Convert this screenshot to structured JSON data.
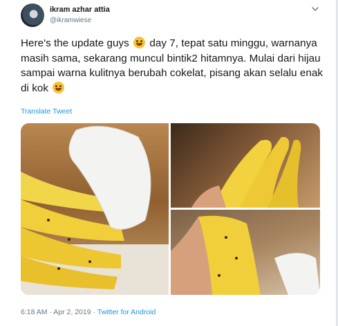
{
  "user": {
    "name": "ikram azhar attia",
    "handle": "@ikramwiese"
  },
  "tweet": {
    "text_part1": "Here's the update guys",
    "text_part2": "day 7, tepat satu minggu, warnanya masih sama, sekarang muncul bintik2 hitamnya. Mulai dari hijau sampai warna kulitnya berubah cokelat, pisang akan selalu enak di kok",
    "translate_label": "Translate Tweet"
  },
  "icons": {
    "menu": "chevron-down-icon",
    "emoji1": "grinning-face-emoji",
    "emoji2": "face-savoring-food-emoji"
  },
  "meta": {
    "timestamp": "6:18 AM · Apr 2, 2019",
    "separator": " · ",
    "source": "Twitter for Android"
  },
  "colors": {
    "link": "#1b95e0",
    "text": "#14171a",
    "secondary": "#657786"
  }
}
